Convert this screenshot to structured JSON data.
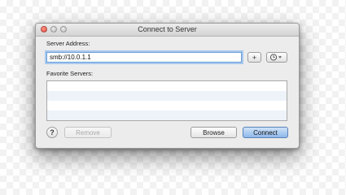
{
  "window": {
    "title": "Connect to Server"
  },
  "server_address": {
    "label": "Server Address:",
    "value": "smb://10.0.1.1",
    "add_button": "+",
    "recent_menu_icon": "clock-dropdown-icon"
  },
  "favorites": {
    "label": "Favorite Servers:",
    "items": []
  },
  "footer": {
    "help": "?",
    "remove": "Remove",
    "browse": "Browse",
    "connect": "Connect"
  },
  "colors": {
    "accent": "#8db7ea",
    "focus_ring": "#a8c9ef",
    "close_button": "#e2463b"
  }
}
